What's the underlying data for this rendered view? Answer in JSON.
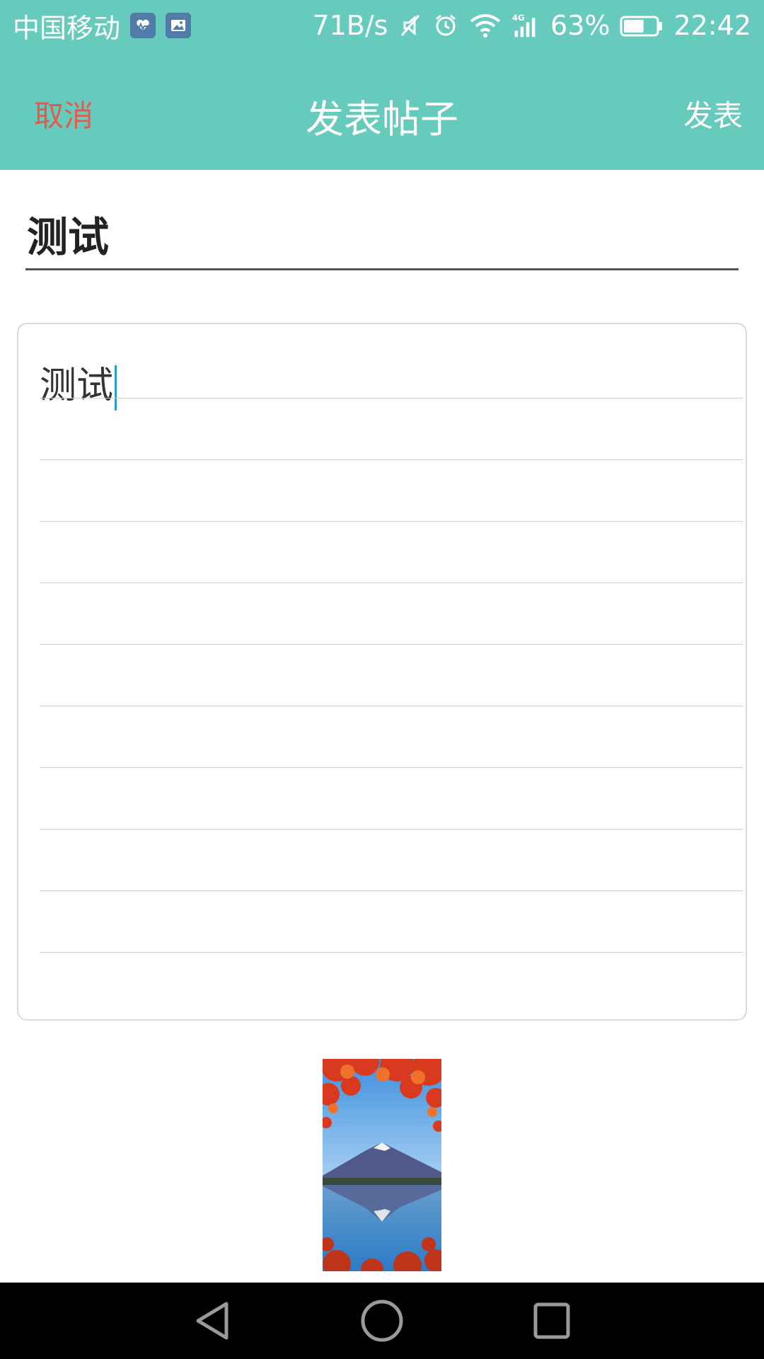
{
  "status_bar": {
    "carrier": "中国移动",
    "net_speed": "71B/s",
    "network_type": "4G",
    "battery_percent": "63%",
    "battery_level": 0.63,
    "time": "22:42",
    "icons": [
      "health-app-icon",
      "gallery-app-icon",
      "mute-icon",
      "alarm-icon",
      "wifi-icon",
      "cell-signal-icon",
      "battery-icon"
    ]
  },
  "header": {
    "cancel_label": "取消",
    "title": "发表帖子",
    "publish_label": "发表"
  },
  "post": {
    "title_value": "测试",
    "content_value": "测试"
  },
  "attachments": {
    "image_icon": "mountain-lake-photo"
  },
  "nav": {
    "icons": [
      "back-icon",
      "home-icon",
      "recents-icon"
    ]
  },
  "colors": {
    "accent": "#66cabd",
    "cancel": "#e05c4f",
    "caret": "#2aa0c9"
  }
}
